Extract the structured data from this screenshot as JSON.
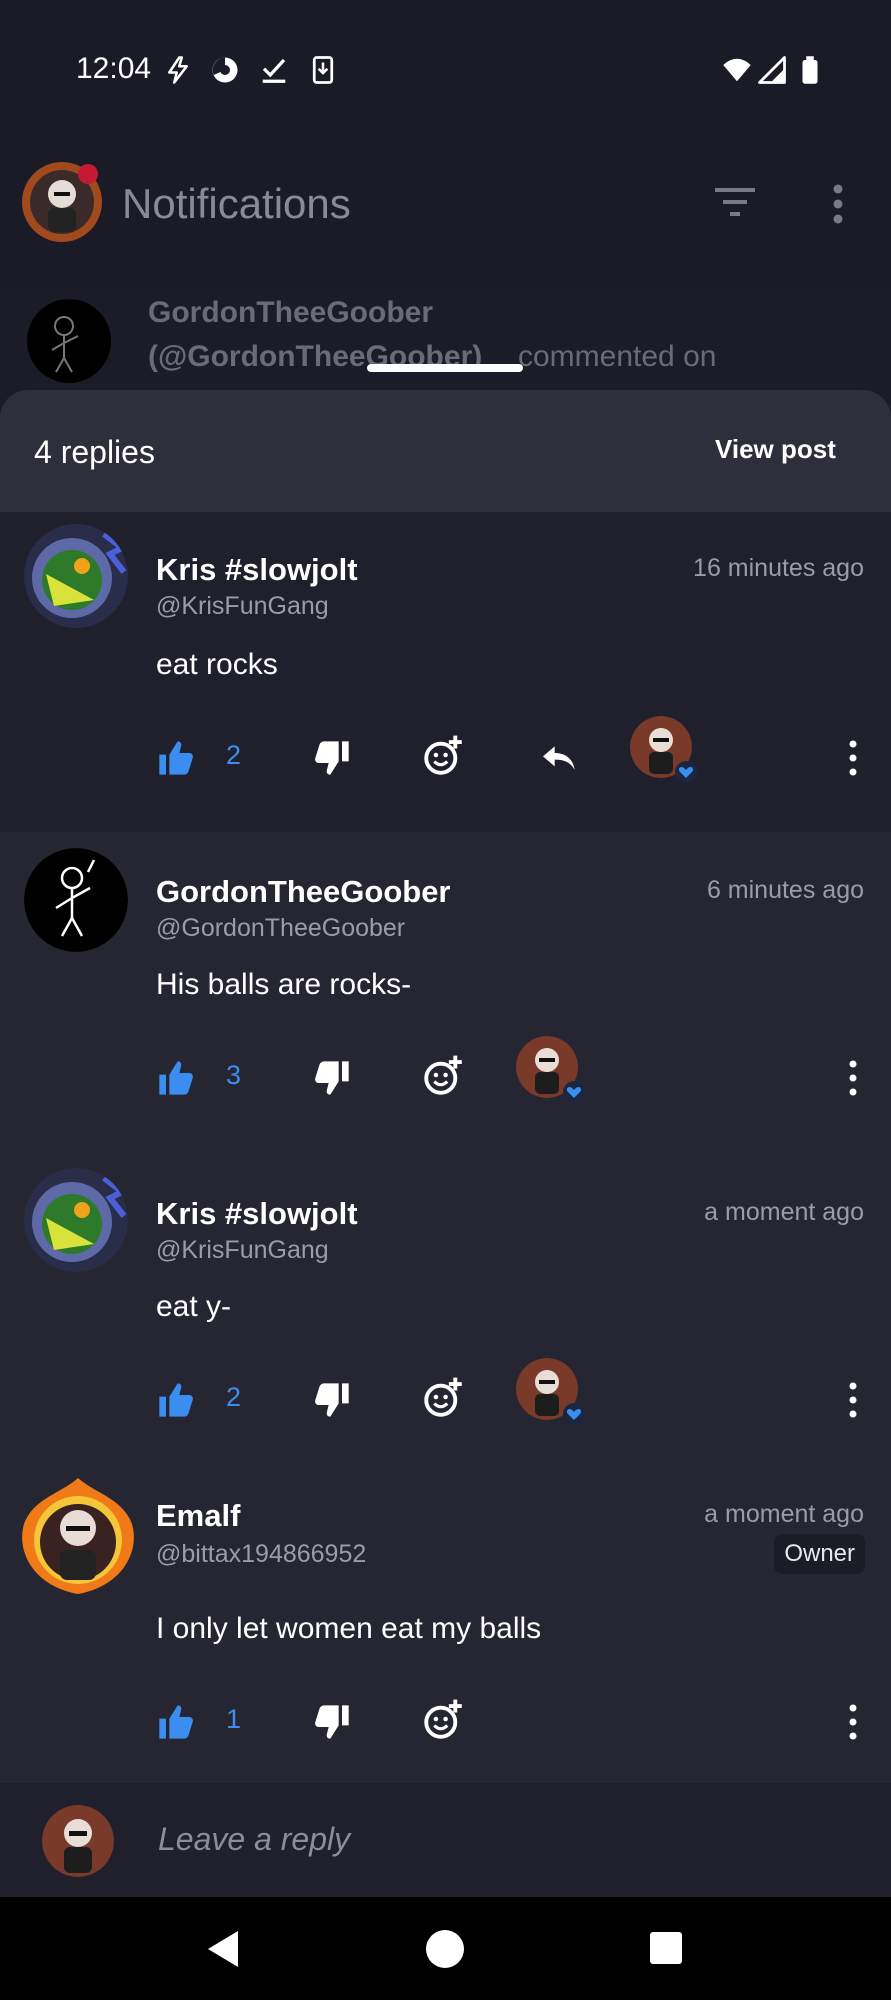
{
  "status_bar": {
    "time": "12:04",
    "left_icons": [
      "flash-icon",
      "data-saver-icon",
      "checkmark-icon",
      "download-icon"
    ],
    "right_icons": [
      "wifi-icon",
      "signal-icon",
      "battery-icon"
    ]
  },
  "header": {
    "title": "Notifications",
    "icons": [
      "filter-icon",
      "more-vertical-icon"
    ]
  },
  "notification": {
    "name": "GordonTheeGoober",
    "handle": "(@GordonTheeGoober)",
    "action": "commented on"
  },
  "sheet": {
    "replies_label": "4 replies",
    "view_post_label": "View post"
  },
  "comments": [
    {
      "name": "Kris #slowjolt",
      "handle": "@KrisFunGang",
      "time": "16 minutes ago",
      "text": "eat rocks",
      "likes": "2",
      "has_reply_button": true
    },
    {
      "name": "GordonTheeGoober",
      "handle": "@GordonTheeGoober",
      "time": "6 minutes ago",
      "text": "His balls are rocks-",
      "likes": "3"
    },
    {
      "name": "Kris #slowjolt",
      "handle": "@KrisFunGang",
      "time": "a moment ago",
      "text": "eat y-",
      "likes": "2"
    },
    {
      "name": "Emalf",
      "handle": "@bittax194866952",
      "time": "a moment ago",
      "badge": "Owner",
      "text": "I only let women eat my balls",
      "likes": "1"
    }
  ],
  "reply_bar": {
    "placeholder": "Leave a reply"
  },
  "colors": {
    "background": "#1c1c28",
    "sheet": "#262633",
    "accent_blue": "#3b8df0",
    "muted_text": "#9c9ca6"
  }
}
